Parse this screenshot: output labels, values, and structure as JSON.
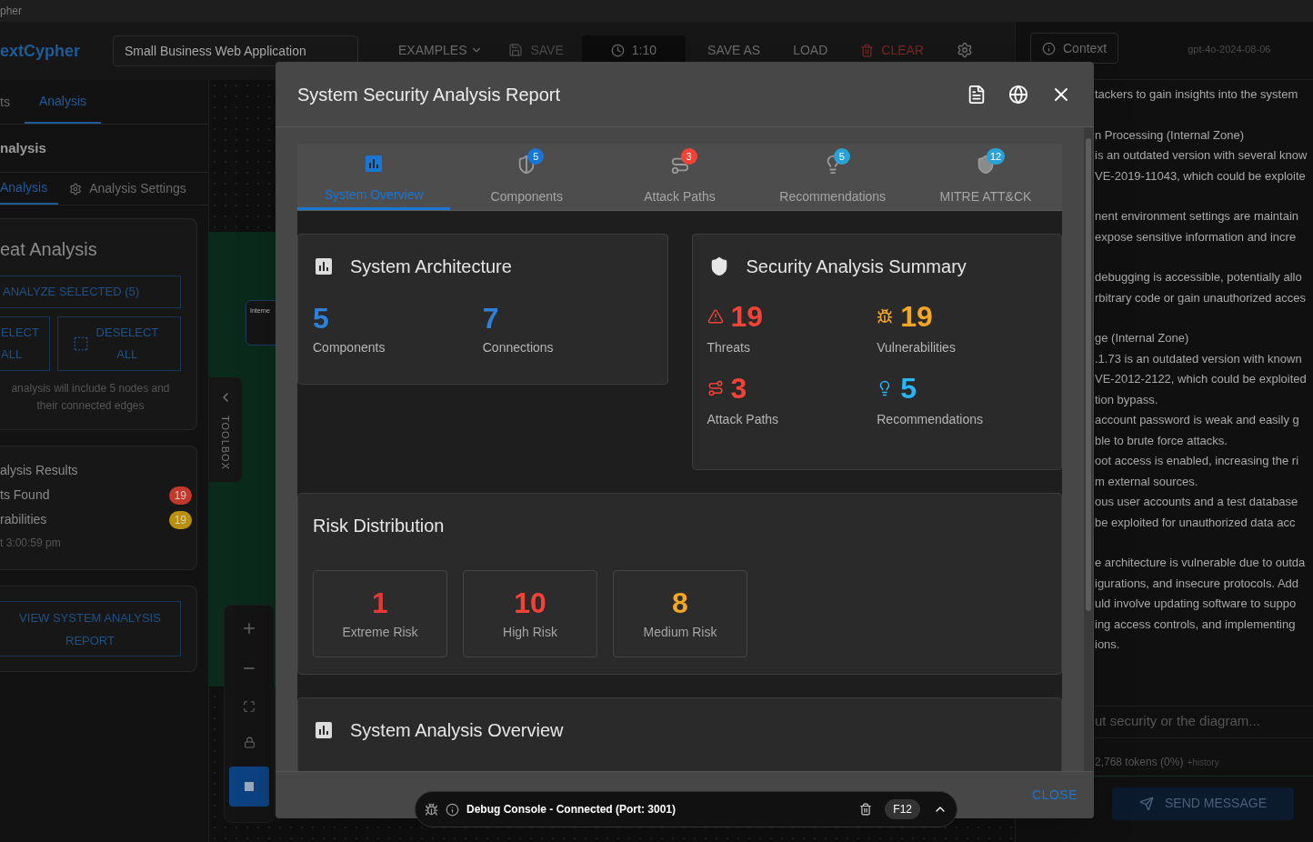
{
  "window": {
    "title": "pher"
  },
  "app_bar": {
    "brand": "extCypher",
    "project_name": "Small Business Web Application",
    "toolbar": [
      {
        "label": "EXAMPLES",
        "kind": "menu"
      },
      {
        "label": "SAVE",
        "kind": "save",
        "disabled": true
      },
      {
        "label": "1:10",
        "kind": "timer"
      },
      {
        "label": "SAVE AS",
        "kind": "text"
      },
      {
        "label": "LOAD",
        "kind": "text"
      },
      {
        "label": "CLEAR",
        "kind": "danger"
      },
      {
        "kind": "settings"
      }
    ]
  },
  "left_panel": {
    "tabs": [
      {
        "label": "ts",
        "selected": false
      },
      {
        "label": "Analysis",
        "selected": true
      }
    ],
    "heading": "nalysis",
    "subtabs": [
      {
        "label": "Analysis",
        "selected": true,
        "kind": "plain"
      },
      {
        "label": "Analysis Settings",
        "selected": false,
        "kind": "settings"
      }
    ],
    "threat_card": {
      "title": "eat Analysis",
      "analyze_button": "ANALYZE SELECTED (5)",
      "select_button": "ELECT ALL",
      "deselect_button": "DESELECT ALL",
      "note": "analysis will include 5 nodes and their connected edges"
    },
    "results_card": {
      "title": "alysis Results",
      "rows": [
        {
          "label": "ts Found",
          "count": "19",
          "color": "#c0392b"
        },
        {
          "label": "rabilities",
          "count": "19",
          "color": "#b8900c"
        }
      ],
      "timestamp": "t 3:00:59 pm"
    },
    "report_button": "VIEW SYSTEM ANALYSIS REPORT"
  },
  "canvas": {
    "node": {
      "title": "Interne"
    },
    "toolbox": "TOOLBOX"
  },
  "right_panel": {
    "context_button": "Context",
    "model": "gpt-4o-2024-08-06",
    "paragraphs": [
      [
        "tackers to gain insights into the system"
      ],
      [
        "n Processing (Internal Zone)",
        "is an outdated version with several know",
        "VE-2019-11043, which could be exploite"
      ],
      [
        "nent environment settings are maintain",
        "expose sensitive information and incre"
      ],
      [
        "debugging is accessible, potentially allo",
        "rbitrary code or gain unauthorized acces"
      ],
      [
        "ge (Internal Zone)",
        ".1.73 is an outdated version with known",
        "VE-2012-2122, which could be exploited",
        "tion bypass.",
        "account password is weak and easily g",
        "ble to brute force attacks.",
        "oot access is enabled, increasing the ri",
        "m external sources.",
        "ous user accounts and a test database",
        "be exploited for unauthorized data acc"
      ],
      [
        "e architecture is vulnerable due to outda",
        "igurations, and insecure protocols. Add",
        "uld involve updating software to suppo",
        "ing access controls, and implementing",
        "ions."
      ]
    ],
    "input_placeholder": "ut security or the diagram...",
    "tokens": "2,768 tokens (0%)",
    "history": "+history",
    "send_button": "SEND MESSAGE"
  },
  "dialog": {
    "title": "System Security Analysis Report",
    "tabs": [
      {
        "label": "System Overview",
        "kind": "overview",
        "selected": true
      },
      {
        "label": "Components",
        "kind": "components",
        "selected": false,
        "badge": "5",
        "color": "#1976d2"
      },
      {
        "label": "Attack Paths",
        "kind": "attack_paths",
        "selected": false,
        "badge": "3",
        "color": "#f44336"
      },
      {
        "label": "Recommendations",
        "kind": "recommendations",
        "selected": false,
        "badge": "5",
        "color": "#29a3d6"
      },
      {
        "label": "MITRE ATT&CK",
        "kind": "mitre",
        "selected": false,
        "badge": "12",
        "color": "#29a3d6"
      }
    ],
    "architecture": {
      "title": "System Architecture",
      "stats": [
        {
          "value": "5",
          "label": "Components",
          "color": "#2f80d8"
        },
        {
          "value": "7",
          "label": "Connections",
          "color": "#2f80d8"
        }
      ]
    },
    "summary": {
      "title": "Security Analysis Summary",
      "stats": [
        {
          "kind": "threat",
          "value": "19",
          "label": "Threats",
          "color": "#f44336"
        },
        {
          "kind": "vulnerability",
          "value": "19",
          "label": "Vulnerabilities",
          "color": "#f5a623"
        },
        {
          "kind": "attack_path",
          "value": "3",
          "label": "Attack Paths",
          "color": "#f44336"
        },
        {
          "kind": "recommendation",
          "value": "5",
          "label": "Recommendations",
          "color": "#29b6f6"
        }
      ]
    },
    "risk": {
      "title": "Risk Distribution",
      "levels": [
        {
          "value": "1",
          "label": "Extreme Risk",
          "color": "#e53935"
        },
        {
          "value": "10",
          "label": "High Risk",
          "color": "#f44336"
        },
        {
          "value": "8",
          "label": "Medium Risk",
          "color": "#f5a623"
        }
      ]
    },
    "overview_title": "System Analysis Overview",
    "close_button": "CLOSE"
  },
  "debug_console": {
    "status": "Debug Console - Connected (Port: 3001)",
    "shortcut": "F12"
  }
}
